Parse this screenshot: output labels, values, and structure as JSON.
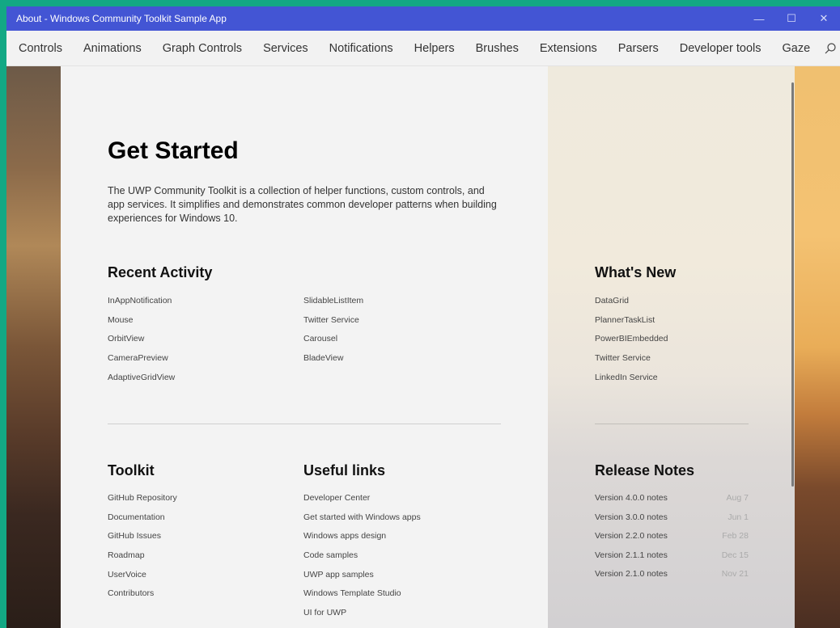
{
  "window": {
    "title": "About - Windows Community Toolkit Sample App",
    "minimize_glyph": "—",
    "maximize_glyph": "☐",
    "close_glyph": "✕"
  },
  "nav": {
    "items": [
      "Controls",
      "Animations",
      "Graph Controls",
      "Services",
      "Notifications",
      "Helpers",
      "Brushes",
      "Extensions",
      "Parsers",
      "Developer tools",
      "Gaze"
    ],
    "icons": [
      "search-icon",
      "home-icon"
    ]
  },
  "page": {
    "title": "Get Started",
    "intro": "The UWP Community Toolkit is a collection of helper functions, custom controls, and app services. It simplifies and demonstrates common developer patterns when building experiences for Windows 10."
  },
  "recent": {
    "heading": "Recent Activity",
    "col1": [
      "InAppNotification",
      "Mouse",
      "OrbitView",
      "CameraPreview",
      "AdaptiveGridView"
    ],
    "col2": [
      "SlidableListItem",
      "Twitter Service",
      "Carousel",
      "BladeView"
    ]
  },
  "whats_new": {
    "heading": "What's New",
    "items": [
      "DataGrid",
      "PlannerTaskList",
      "PowerBIEmbedded",
      "Twitter Service",
      "LinkedIn Service"
    ]
  },
  "toolkit": {
    "heading": "Toolkit",
    "items": [
      "GitHub Repository",
      "Documentation",
      "GitHub Issues",
      "Roadmap",
      "UserVoice",
      "Contributors"
    ]
  },
  "useful": {
    "heading": "Useful links",
    "items": [
      "Developer Center",
      "Get started with Windows apps",
      "Windows apps design",
      "Code samples",
      "UWP app samples",
      "Windows Template Studio",
      "UI for UWP"
    ]
  },
  "release": {
    "heading": "Release Notes",
    "items": [
      {
        "name": "Version 4.0.0 notes",
        "date": "Aug 7"
      },
      {
        "name": "Version 3.0.0 notes",
        "date": "Jun 1"
      },
      {
        "name": "Version 2.2.0 notes",
        "date": "Feb 28"
      },
      {
        "name": "Version 2.1.1 notes",
        "date": "Dec 15"
      },
      {
        "name": "Version 2.1.0 notes",
        "date": "Nov 21"
      }
    ]
  },
  "colors": {
    "titlebar": "#4355d4",
    "border": "#13a884"
  }
}
